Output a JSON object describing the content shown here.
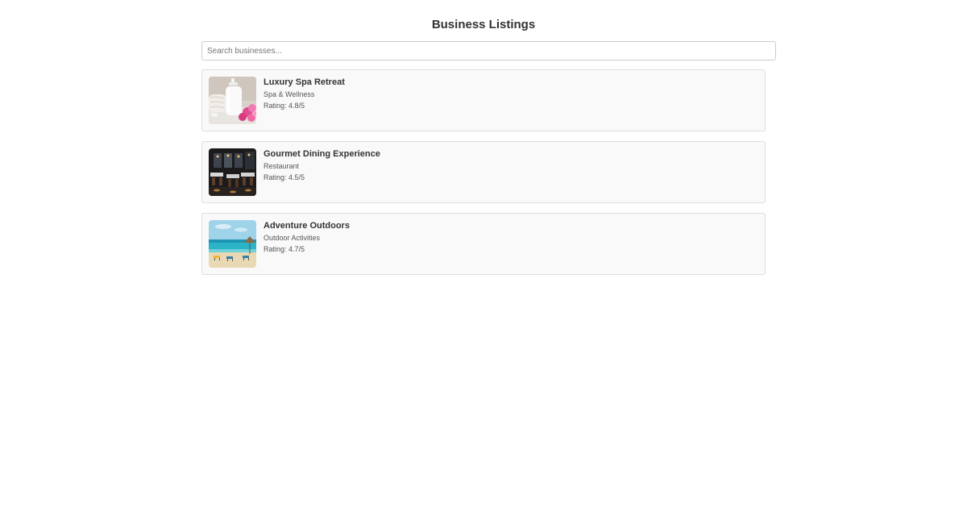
{
  "page": {
    "title": "Business Listings"
  },
  "search": {
    "placeholder": "Search businesses..."
  },
  "listings": [
    {
      "name": "Luxury Spa Retreat",
      "category": "Spa & Wellness",
      "rating": "Rating: 4.8/5",
      "image": "spa-photo"
    },
    {
      "name": "Gourmet Dining Experience",
      "category": "Restaurant",
      "rating": "Rating: 4.5/5",
      "image": "restaurant-photo"
    },
    {
      "name": "Adventure Outdoors",
      "category": "Outdoor Activities",
      "rating": "Rating: 4.7/5",
      "image": "beach-photo"
    }
  ]
}
